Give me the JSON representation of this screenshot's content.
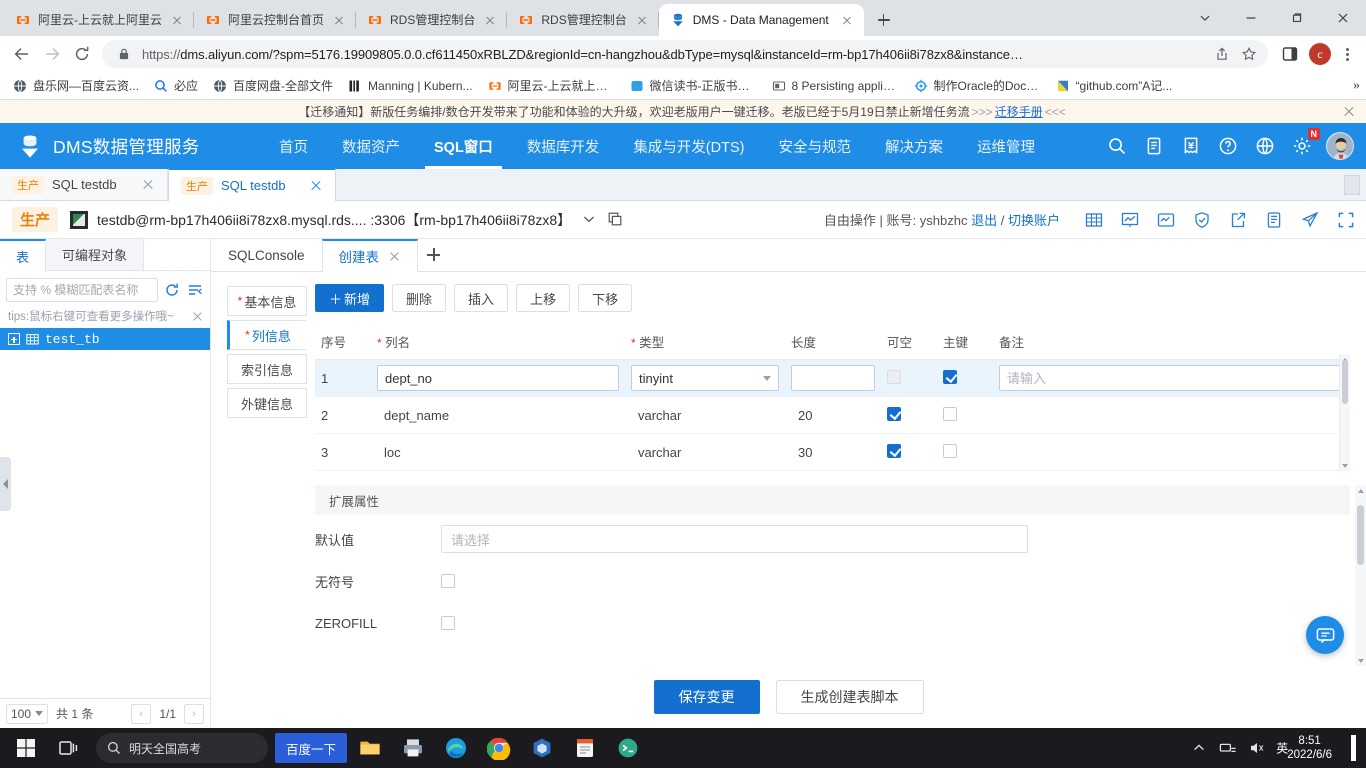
{
  "browser": {
    "tabs": [
      {
        "title": "阿里云-上云就上阿里云",
        "favicon": "aliyun-icon",
        "active": false
      },
      {
        "title": "阿里云控制台首页",
        "favicon": "aliyun-icon",
        "active": false
      },
      {
        "title": "RDS管理控制台",
        "favicon": "aliyun-icon",
        "active": false
      },
      {
        "title": "RDS管理控制台",
        "favicon": "aliyun-icon",
        "active": false
      },
      {
        "title": "DMS - Data Management",
        "favicon": "dms-icon",
        "active": true
      }
    ],
    "new_tab_label": "+",
    "window_controls": {
      "minimize": "−",
      "maximize": "▢",
      "close": "✕",
      "list": "⌄"
    },
    "url_scheme": "https://",
    "url": "dms.aliyun.com/?spm=5176.19909805.0.0.cf611450xRBLZD&regionId=cn-hangzhou&dbType=mysql&instanceId=rm-bp17h406ii8i78zx8&instance…",
    "profile_initial": "c",
    "bookmarks": [
      {
        "label": "盘乐网—百度云资...",
        "icon": "globe-icon"
      },
      {
        "label": "必应",
        "icon": "search-icon"
      },
      {
        "label": "百度网盘-全部文件",
        "icon": "globe-icon"
      },
      {
        "label": "Manning | Kubern...",
        "icon": "manning-icon"
      },
      {
        "label": "阿里云-上云就上阿...",
        "icon": "aliyun-icon"
      },
      {
        "label": "微信读书-正版书籍...",
        "icon": "wechat-icon"
      },
      {
        "label": "8 Persisting applic...",
        "icon": "note-icon"
      },
      {
        "label": "制作Oracle的Dock...",
        "icon": "docker-icon"
      },
      {
        "label": "“github.com”A记...",
        "icon": "file-icon"
      }
    ],
    "bookmarks_overflow": "»"
  },
  "notice": {
    "prefix": "【迁移通知】",
    "text": "新版任务编排/数仓开发带来了功能和体验的大升级，欢迎老版用户一键迁移。老版已经于5月19日禁止新增任务流",
    "arrows_right": ">>>",
    "link": "迁移手册",
    "arrows_left": "<<<"
  },
  "dms": {
    "brand": "DMS数据管理服务",
    "nav": [
      {
        "label": "首页",
        "active": false
      },
      {
        "label": "数据资产",
        "active": false
      },
      {
        "label": "SQL窗口",
        "active": true
      },
      {
        "label": "数据库开发",
        "active": false
      },
      {
        "label": "集成与开发(DTS)",
        "active": false
      },
      {
        "label": "安全与规范",
        "active": false
      },
      {
        "label": "解决方案",
        "active": false
      },
      {
        "label": "运维管理",
        "active": false
      }
    ],
    "header_icons": [
      {
        "name": "search-icon"
      },
      {
        "name": "document-icon"
      },
      {
        "name": "billing-icon"
      },
      {
        "name": "help-icon"
      },
      {
        "name": "globe-icon"
      },
      {
        "name": "gear-icon",
        "badge": "N"
      }
    ]
  },
  "session_tabs": [
    {
      "env": "生产",
      "label": "SQL testdb",
      "active": false
    },
    {
      "env": "生产",
      "label": "SQL testdb",
      "active": true
    }
  ],
  "connection": {
    "env": "生产",
    "text": "testdb@rm-bp17h406ii8i78zx8.mysql.rds.... :3306【rm-bp17h406ii8i78zx8】",
    "mode": "自由操作",
    "account_label": "账号:",
    "account": "yshbzhc",
    "logout": "退出",
    "separator": "/",
    "switch_account": "切换账户",
    "right_icons": [
      {
        "name": "table-grid-icon"
      },
      {
        "name": "chart-icon"
      },
      {
        "name": "monitor-icon"
      },
      {
        "name": "shield-icon"
      },
      {
        "name": "export-icon"
      },
      {
        "name": "list-icon"
      },
      {
        "name": "send-icon"
      },
      {
        "name": "fullscreen-icon"
      }
    ]
  },
  "sidebar": {
    "tabs": [
      {
        "label": "表",
        "active": true
      },
      {
        "label": "可编程对象",
        "active": false
      }
    ],
    "search_placeholder": "支持 % 模糊匹配表名称",
    "search_value": "",
    "refresh_icon": "refresh-icon",
    "filter_icon": "filter-icon",
    "tips": "tips:鼠标右键可查看更多操作哦~",
    "tree": [
      {
        "label": "test_tb",
        "selected": true
      }
    ],
    "page_size": "100",
    "total_text": "共 1 条",
    "page_indicator": "1/1",
    "prev": "‹",
    "next": "›"
  },
  "editor": {
    "tabs": [
      {
        "label": "SQLConsole",
        "active": false,
        "closable": false
      },
      {
        "label": "创建表",
        "active": true,
        "closable": true
      }
    ],
    "steps": [
      {
        "label": "基本信息",
        "required": true,
        "active": false
      },
      {
        "label": "列信息",
        "required": true,
        "active": true
      },
      {
        "label": "索引信息",
        "required": false,
        "active": false
      },
      {
        "label": "外键信息",
        "required": false,
        "active": false
      }
    ],
    "toolbar": [
      {
        "label": "新增",
        "primary": true,
        "plus": "＋"
      },
      {
        "label": "删除",
        "primary": false
      },
      {
        "label": "插入",
        "primary": false
      },
      {
        "label": "上移",
        "primary": false
      },
      {
        "label": "下移",
        "primary": false
      }
    ],
    "grid": {
      "columns": [
        {
          "key": "seq",
          "label": "序号",
          "required": false
        },
        {
          "key": "name",
          "label": "列名",
          "required": true
        },
        {
          "key": "type",
          "label": "类型",
          "required": true
        },
        {
          "key": "length",
          "label": "长度",
          "required": false
        },
        {
          "key": "nullable",
          "label": "可空",
          "required": false
        },
        {
          "key": "pk",
          "label": "主键",
          "required": false
        },
        {
          "key": "comment",
          "label": "备注",
          "required": false
        }
      ],
      "rows": [
        {
          "seq": "1",
          "name": "dept_no",
          "type": "tinyint",
          "length": "",
          "nullable": false,
          "nullable_disabled": true,
          "pk": true,
          "comment": "",
          "comment_placeholder": "请输入",
          "editing": true
        },
        {
          "seq": "2",
          "name": "dept_name",
          "type": "varchar",
          "length": "20",
          "nullable": true,
          "nullable_disabled": false,
          "pk": false,
          "comment": "",
          "editing": false
        },
        {
          "seq": "3",
          "name": "loc",
          "type": "varchar",
          "length": "30",
          "nullable": true,
          "nullable_disabled": false,
          "pk": false,
          "comment": "",
          "editing": false
        }
      ]
    },
    "extended": {
      "title": "扩展属性",
      "default_value_label": "默认值",
      "default_value_placeholder": "请选择",
      "unsigned_label": "无符号",
      "unsigned_checked": false,
      "zerofill_label": "ZEROFILL",
      "zerofill_checked": false
    },
    "footer": {
      "save_label": "保存变更",
      "script_label": "生成创建表脚本"
    },
    "fab_icon": "chat-support-icon"
  },
  "taskbar": {
    "start_icon": "windows-icon",
    "taskview_icon": "task-view-icon",
    "search_placeholder": "明天全国高考",
    "search_icon": "search-icon",
    "baidu_button": "百度一下",
    "apps": [
      {
        "name": "file-explorer-icon"
      },
      {
        "name": "printer-icon"
      },
      {
        "name": "edge-icon"
      },
      {
        "name": "chrome-icon"
      },
      {
        "name": "virtualbox-icon"
      },
      {
        "name": "notepad-icon"
      },
      {
        "name": "xshell-icon"
      }
    ],
    "tray": [
      {
        "name": "chevron-up-icon"
      },
      {
        "name": "network-icon"
      },
      {
        "name": "volume-icon"
      },
      {
        "name": "ime-label",
        "label": "英"
      }
    ],
    "time": "8:51",
    "date": "2022/6/6"
  },
  "colors": {
    "dms_blue": "#1f8ce6",
    "primary_blue": "#1370cf",
    "env_orange": "#e8820c",
    "notice_bg": "#fdf6ec",
    "required_red": "#e03131"
  }
}
